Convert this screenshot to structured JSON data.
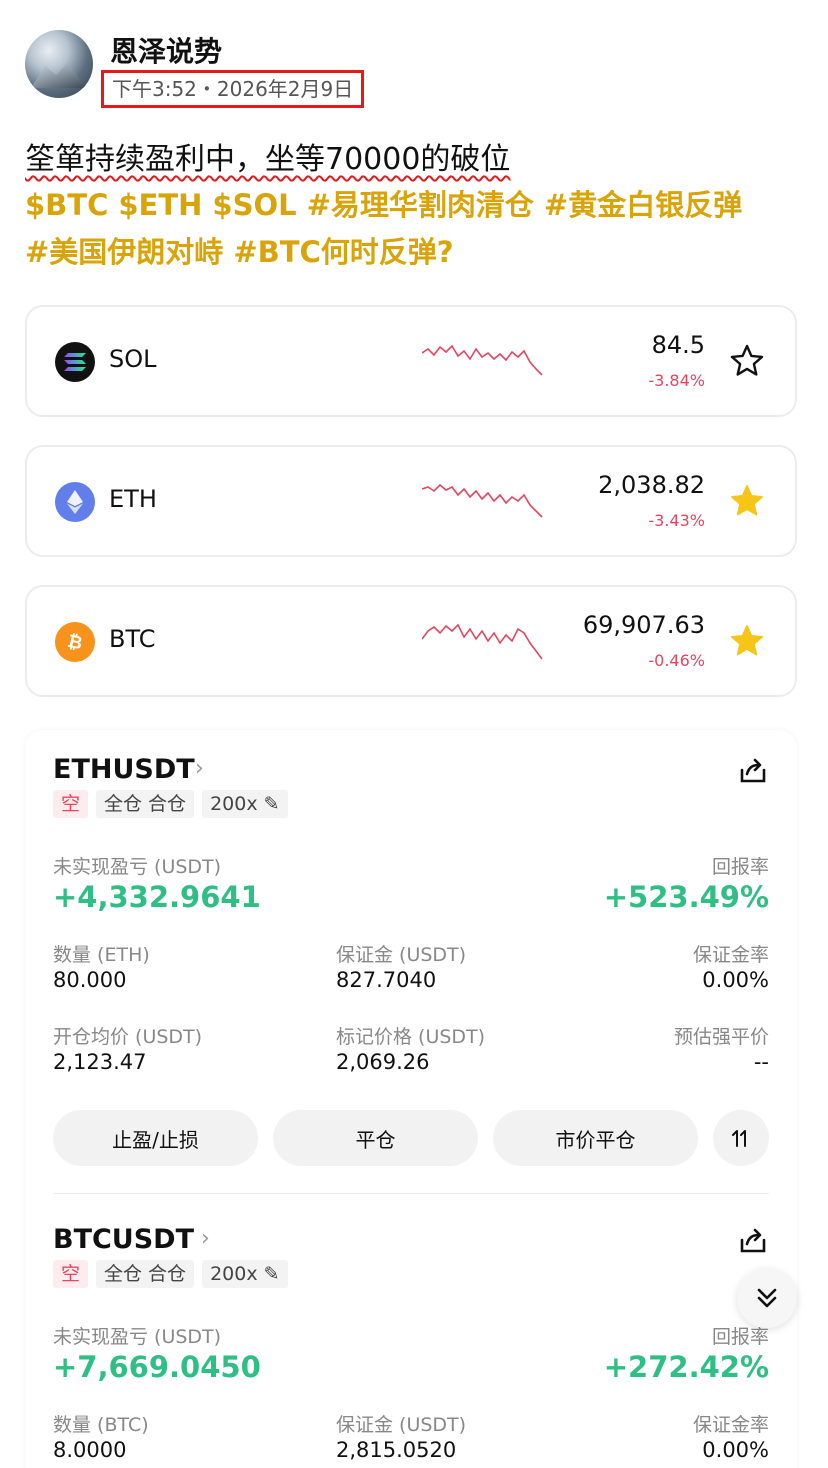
{
  "post": {
    "author": "恩泽说势",
    "timestamp": "下午3:52・2026年2月9日",
    "line1": "筌箪持续盈利中，坐等70000的破位",
    "tags_line1": [
      "$BTC",
      "$ETH",
      "$SOL",
      "#易理华割肉清仓",
      "#黄金白银反弹"
    ],
    "tags_line2": [
      "#美国伊朗对峙",
      "#BTC何时反弹?"
    ]
  },
  "coins": [
    {
      "name": "SOL",
      "price": "84.5",
      "change": "-3.84%",
      "starred": false,
      "icon": "solana-icon"
    },
    {
      "name": "ETH",
      "price": "2,038.82",
      "change": "-3.43%",
      "starred": true,
      "icon": "ethereum-icon"
    },
    {
      "name": "BTC",
      "price": "69,907.63",
      "change": "-0.46%",
      "starred": true,
      "icon": "bitcoin-icon"
    }
  ],
  "positions": [
    {
      "symbol": "ETHUSDT",
      "side": "空",
      "mode": "全仓 合仓",
      "leverage": "200x",
      "pnl_label": "未实现盈亏 (USDT)",
      "pnl": "+4,332.9641",
      "roe_label": "回报率",
      "roe": "+523.49%",
      "qty_label": "数量 (ETH)",
      "qty": "80.000",
      "margin_label": "保证金 (USDT)",
      "margin": "827.7040",
      "margin_rate_label": "保证金率",
      "margin_rate": "0.00%",
      "entry_label": "开仓均价 (USDT)",
      "entry": "2,123.47",
      "mark_label": "标记价格 (USDT)",
      "mark": "2,069.26",
      "liq_label": "预估强平价",
      "liq": "--"
    },
    {
      "symbol": "BTCUSDT",
      "side": "空",
      "mode": "全仓 合仓",
      "leverage": "200x",
      "pnl_label": "未实现盈亏 (USDT)",
      "pnl": "+7,669.0450",
      "roe_label": "回报率",
      "roe": "+272.42%",
      "qty_label": "数量 (BTC)",
      "qty": "8.0000",
      "margin_label": "保证金 (USDT)",
      "margin": "2,815.0520",
      "margin_rate_label": "保证金率",
      "margin_rate": "0.00%"
    }
  ],
  "actions": {
    "tp_sl": "止盈/止损",
    "close": "平仓",
    "market_close": "市价平仓"
  },
  "colors": {
    "hashtag": "#d8a40a",
    "negative": "#e64560",
    "positive": "#2fbf85",
    "highlight_box": "#e8181b",
    "star_filled": "#f5c518"
  }
}
